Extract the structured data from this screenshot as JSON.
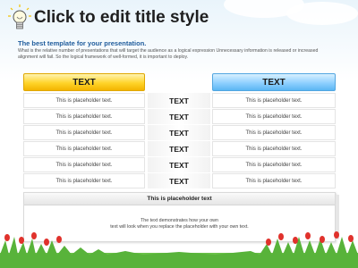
{
  "slide": {
    "title": "Click to edit title style",
    "subtitle": "The best template for your presentation.",
    "description": "What is the relative number of presentations that will target the audience as a logical expression Unnecessary information is released or increased alignment will fail. So the logical framework of well-formed, it is important to deploy."
  },
  "table": {
    "left_header": "TEXT",
    "right_header": "TEXT",
    "rows": [
      {
        "left": "This is placeholder text.",
        "mid": "TEXT",
        "right": "This is placeholder text."
      },
      {
        "left": "This is placeholder text.",
        "mid": "TEXT",
        "right": "This is placeholder text."
      },
      {
        "left": "This is placeholder text.",
        "mid": "TEXT",
        "right": "This is placeholder text."
      },
      {
        "left": "This is placeholder text.",
        "mid": "TEXT",
        "right": "This is placeholder text."
      },
      {
        "left": "This is placeholder text.",
        "mid": "TEXT",
        "right": "This is placeholder text."
      },
      {
        "left": "This is placeholder text.",
        "mid": "TEXT",
        "right": "This is placeholder text."
      }
    ]
  },
  "footer": {
    "title": "This is placeholder text",
    "line1": "The text demonstrates how your own",
    "line2": "text will look when you replace the placeholder with your own text."
  },
  "colors": {
    "left_header": "#ffd42a",
    "right_header": "#8fd0ff",
    "subtitle": "#1f5c9c"
  },
  "icons": [
    "lightbulb-icon"
  ]
}
